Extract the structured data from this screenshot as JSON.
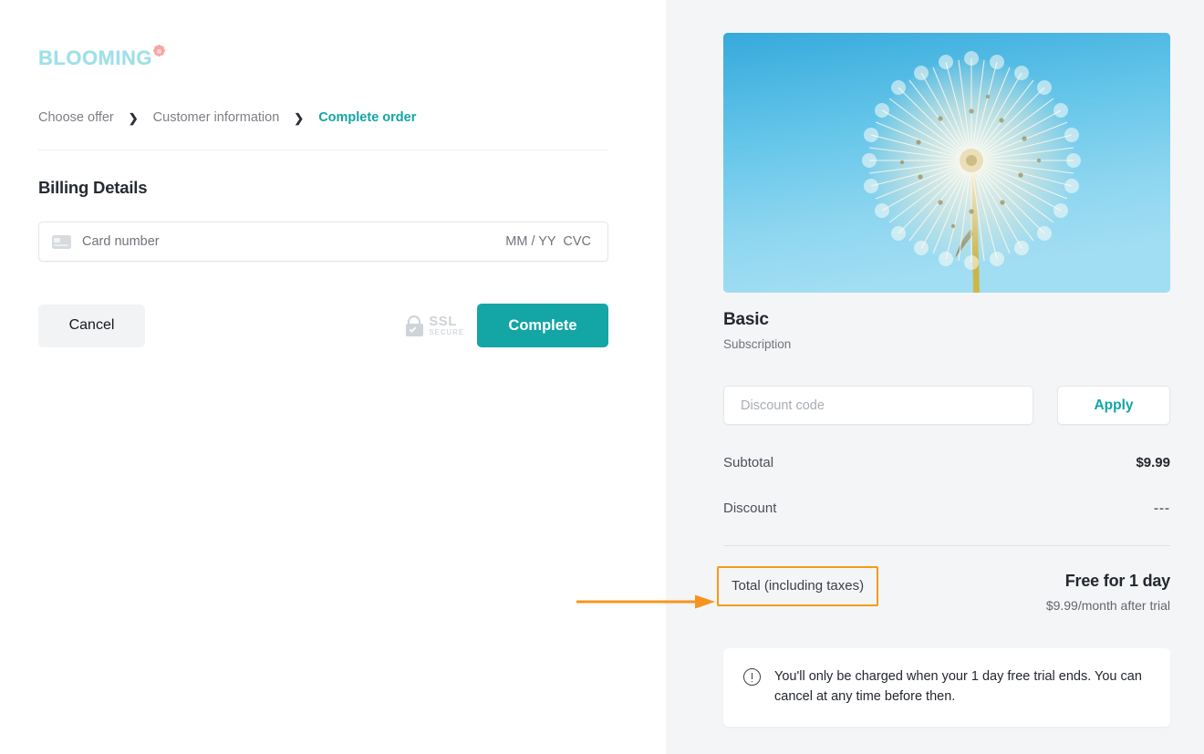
{
  "brand": {
    "logo_text": "BLOOMING",
    "logo_color": "#9fe0e8",
    "flower_color": "#f7a6a6"
  },
  "breadcrumb": {
    "separator": "❯",
    "steps": [
      {
        "label": "Choose offer",
        "active": false
      },
      {
        "label": "Customer information",
        "active": false
      },
      {
        "label": "Complete order",
        "active": true
      }
    ]
  },
  "billing": {
    "title": "Billing Details",
    "card_icon": "credit-card-icon",
    "card_placeholder": "Card number",
    "card_value": "",
    "expiry_cvc_placeholder": "MM / YY  CVC"
  },
  "actions": {
    "cancel_label": "Cancel",
    "complete_label": "Complete",
    "complete_color": "#14a5a5",
    "ssl_badge": {
      "icon": "padlock-check-icon",
      "main": "SSL",
      "sub": "SECURE"
    }
  },
  "summary": {
    "hero_image": "dandelion-blue-sky-photo",
    "product_name": "Basic",
    "product_type": "Subscription",
    "discount": {
      "placeholder": "Discount code",
      "value": "",
      "apply_label": "Apply",
      "apply_color": "#12a5a5"
    },
    "lines": [
      {
        "label": "Subtotal",
        "value": "$9.99",
        "muted": false
      },
      {
        "label": "Discount",
        "value": "---",
        "muted": true
      }
    ],
    "total": {
      "label": "Total (including taxes)",
      "amount": "Free for 1 day",
      "note": "$9.99/month after trial",
      "highlight_color": "#f59a16"
    },
    "notice": {
      "icon": "info-circle-icon",
      "line1": "You'll only be charged when your 1 day free trial ends.",
      "line2": "You can cancel at any time before then."
    }
  },
  "annotation": {
    "arrow_color": "#f7941e",
    "points_to": "Total (including taxes)"
  }
}
